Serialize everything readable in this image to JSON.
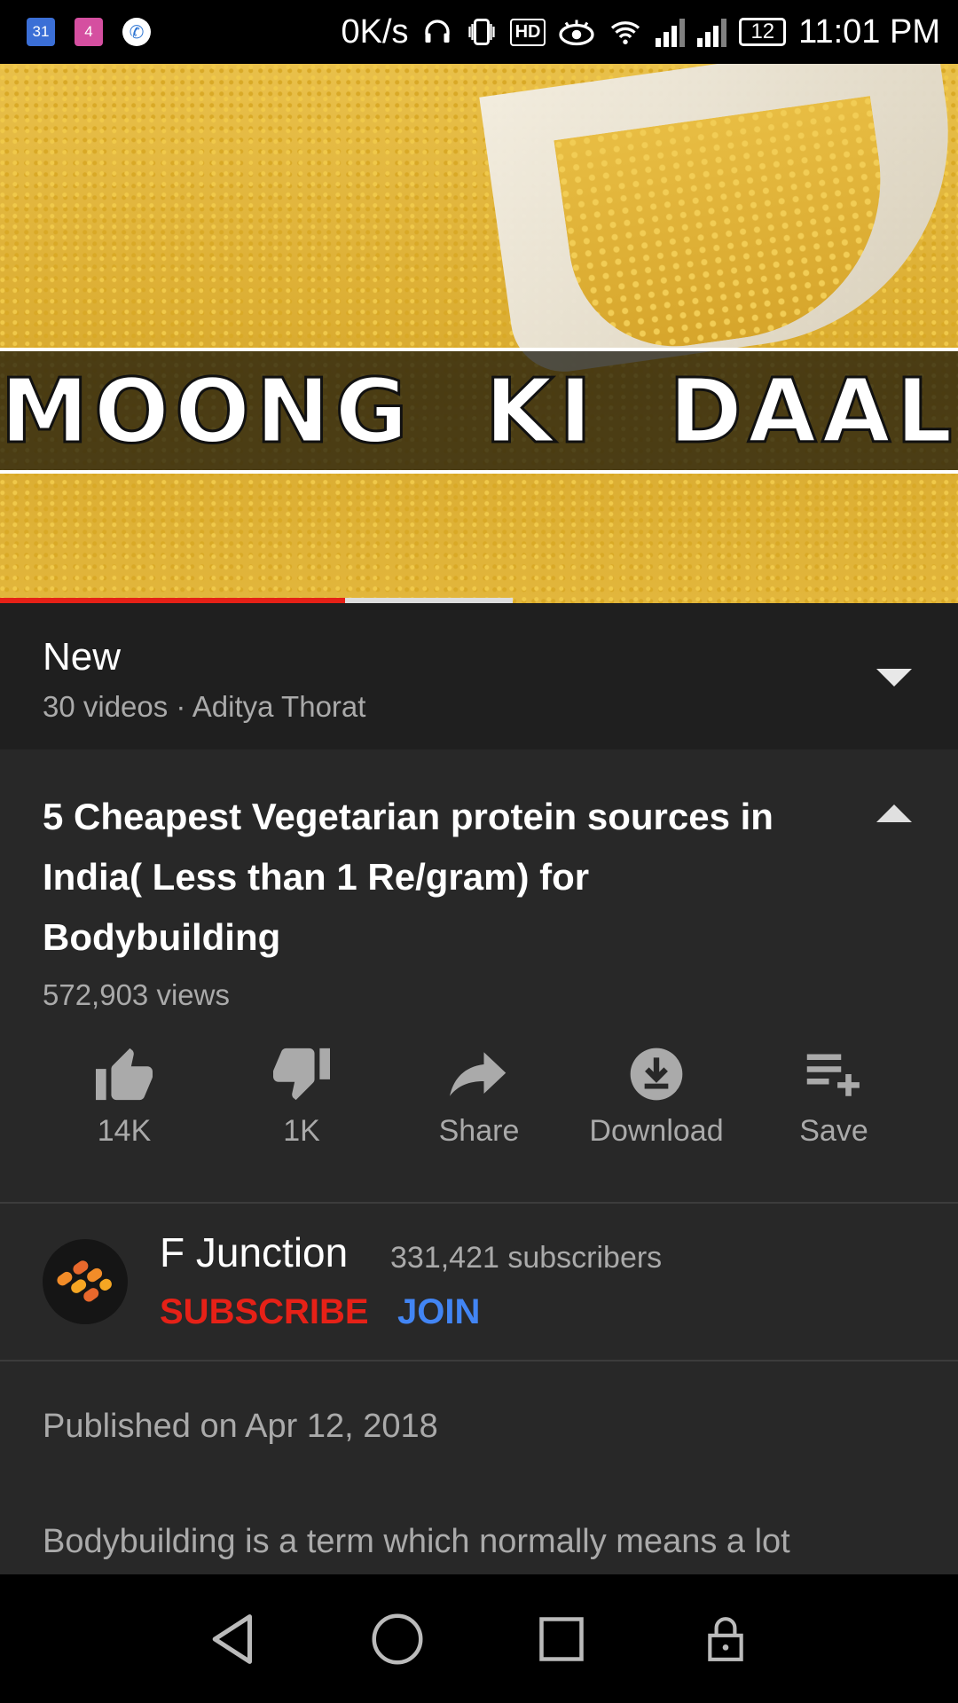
{
  "status_bar": {
    "notif_icons": [
      "calendar-icon",
      "calendar-badge-icon",
      "phone-icon"
    ],
    "calendar_day": "31",
    "calendar_badge": "4",
    "net_speed": "0K/s",
    "hd_label": "HD",
    "battery": "12",
    "time": "11:01 PM"
  },
  "video": {
    "overlay_text": "MOONG KI DAAL",
    "progress_played": 0.36,
    "progress_buffered_end": 0.535
  },
  "playlist": {
    "title": "New",
    "subtitle": "30 videos · Aditya Thorat"
  },
  "details": {
    "title": "5 Cheapest Vegetarian protein sources in India( Less than 1 Re/gram) for Bodybuilding",
    "views": "572,903 views"
  },
  "actions": [
    {
      "icon": "thumbs-up-icon",
      "label": "14K"
    },
    {
      "icon": "thumbs-down-icon",
      "label": "1K"
    },
    {
      "icon": "share-icon",
      "label": "Share"
    },
    {
      "icon": "download-icon",
      "label": "Download"
    },
    {
      "icon": "add-to-playlist-icon",
      "label": "Save"
    }
  ],
  "channel": {
    "name": "F Junction",
    "subscribers": "331,421 subscribers",
    "subscribe_label": "SUBSCRIBE",
    "join_label": "JOIN"
  },
  "description": {
    "published": "Published on Apr 12, 2018",
    "text": "Bodybuilding is a term which normally means a lot"
  },
  "nav": [
    "back-icon",
    "home-icon",
    "recents-icon",
    "lock-icon"
  ],
  "colors": {
    "accent_red": "#e62117",
    "join_blue": "#4285f4",
    "panel_bg": "#282828",
    "header_bg": "#1f1f1f"
  }
}
